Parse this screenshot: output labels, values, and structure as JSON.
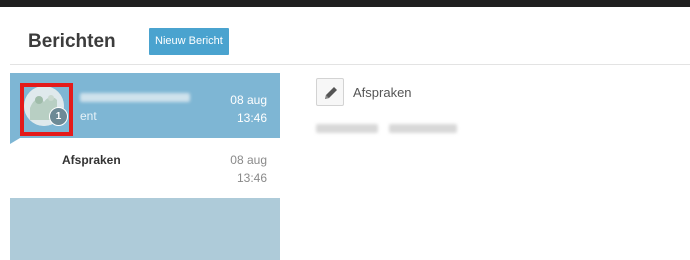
{
  "header": {
    "title": "Berichten",
    "new_message_label": "Nieuw Bericht"
  },
  "message_list": {
    "items": [
      {
        "sender_visible_fragment": "ent",
        "date": "08 aug",
        "time": "13:46",
        "unread_count": "1",
        "selected": true
      },
      {
        "subject": "Afspraken",
        "date": "08 aug",
        "time": "13:46",
        "selected": false
      }
    ]
  },
  "detail": {
    "subject": "Afspraken",
    "icon": "pencil-icon"
  },
  "colors": {
    "accent": "#4aa3cf",
    "selected_item": "#7eb6d4",
    "list_background": "#aecbd9",
    "highlight": "#e41a1a"
  }
}
